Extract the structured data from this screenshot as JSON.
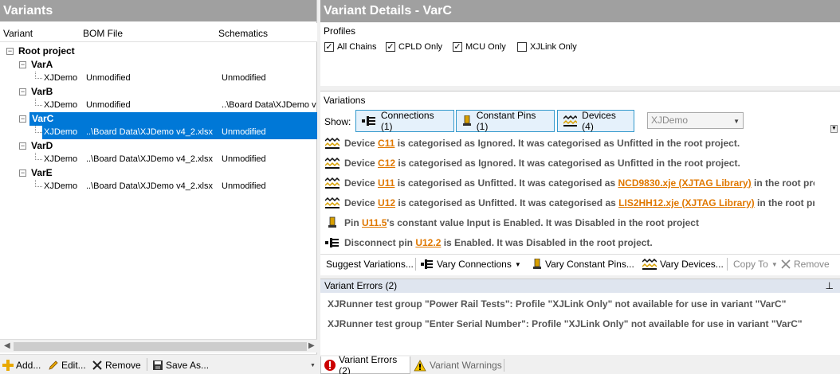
{
  "left": {
    "title": "Variants",
    "columns": [
      "Variant",
      "BOM File",
      "Schematics"
    ],
    "root_label": "Root project",
    "variants": [
      {
        "name": "VarA",
        "child": "XJDemo",
        "bom": "Unmodified",
        "schem": "Unmodified"
      },
      {
        "name": "VarB",
        "child": "XJDemo",
        "bom": "Unmodified",
        "schem": "..\\Board Data\\XJDemo v"
      },
      {
        "name": "VarC",
        "child": "XJDemo",
        "bom": "..\\Board Data\\XJDemo v4_2.xlsx",
        "schem": "Unmodified"
      },
      {
        "name": "VarD",
        "child": "XJDemo",
        "bom": "..\\Board Data\\XJDemo v4_2.xlsx",
        "schem": "Unmodified"
      },
      {
        "name": "VarE",
        "child": "XJDemo",
        "bom": "..\\Board Data\\XJDemo v4_2.xlsx",
        "schem": "Unmodified"
      }
    ],
    "toolbar": {
      "add": "Add...",
      "edit": "Edit...",
      "remove": "Remove",
      "save_as": "Save As..."
    }
  },
  "right": {
    "title": "Variant Details - VarC",
    "profiles": {
      "title": "Profiles",
      "items": [
        {
          "label": "All Chains",
          "checked": "✓"
        },
        {
          "label": "CPLD Only",
          "checked": "✓"
        },
        {
          "label": "MCU Only",
          "checked": "✓"
        },
        {
          "label": "XJLink Only",
          "checked": ""
        }
      ]
    },
    "variations": {
      "title": "Variations",
      "show_label": "Show:",
      "filters": [
        "Connections (1)",
        "Constant Pins (1)",
        "Devices (4)"
      ],
      "dropdown": "XJDemo",
      "messages": [
        {
          "icon": "device-icon",
          "pre": "Device ",
          "link": "C11",
          "post": " is categorised as Ignored. It was categorised as Unfitted in the root project."
        },
        {
          "icon": "device-icon",
          "pre": "Device ",
          "link": "C12",
          "post": " is categorised as Ignored. It was categorised as Unfitted in the root project."
        },
        {
          "icon": "device-icon",
          "pre": "Device ",
          "link": "U11",
          "post": " is categorised as Unfitted. It was categorised as ",
          "link2": "NCD9830.xje (XJTAG Library)",
          "post2": " in the root project."
        },
        {
          "icon": "device-icon",
          "pre": "Device ",
          "link": "U12",
          "post": " is categorised as Unfitted. It was categorised as ",
          "link2": "LIS2HH12.xje (XJTAG Library)",
          "post2": " in the root project."
        },
        {
          "icon": "constant-pin-icon",
          "pre": "Pin ",
          "link": "U11.5",
          "post": "'s constant value Input is Enabled. It was Disabled in the root project"
        },
        {
          "icon": "connection-icon",
          "pre": "Disconnect pin ",
          "link": "U12.2",
          "post": " is Enabled. It was Disabled in the root project."
        }
      ],
      "suggest": {
        "suggest": "Suggest Variations...",
        "vary_conn": "Vary Connections",
        "vary_pins": "Vary Constant Pins...",
        "vary_dev": "Vary Devices...",
        "copy_to": "Copy To",
        "remove": "Remove"
      }
    },
    "errors": {
      "header": "Variant Errors (2)",
      "items": [
        "XJRunner test group \"Power Rail Tests\": Profile \"XJLink Only\" not available for use in variant \"VarC\"",
        "XJRunner test group \"Enter Serial Number\": Profile \"XJLink Only\" not available for use in variant \"VarC\""
      ]
    },
    "tabs": {
      "errors": "Variant Errors (2)",
      "warnings": "Variant Warnings"
    }
  },
  "colors": {
    "selection": "#0078d7",
    "link": "#e07800",
    "header": "#a0a0a0"
  }
}
